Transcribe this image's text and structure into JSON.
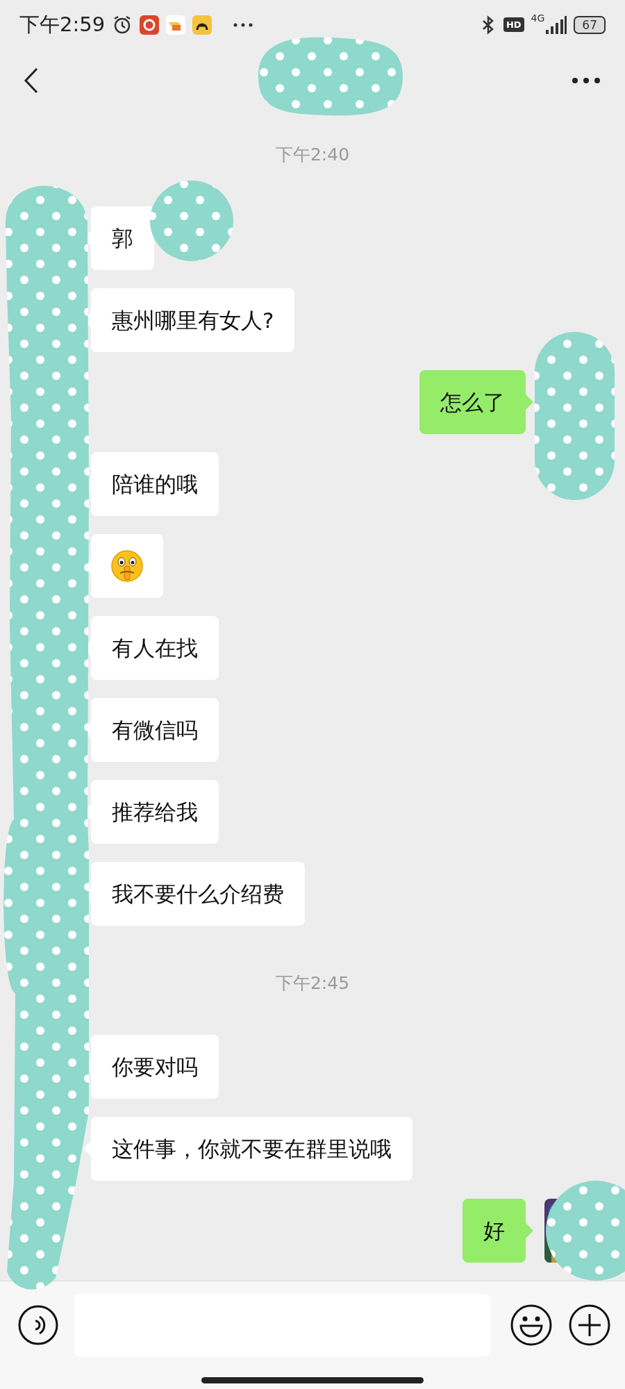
{
  "status_bar": {
    "time": "下午2:59",
    "hd": "HD",
    "network": "4G",
    "battery": "67"
  },
  "messages": [
    {
      "kind": "time",
      "text": "下午2:40"
    },
    {
      "kind": "text",
      "outgoing": false,
      "text": "郭"
    },
    {
      "kind": "text",
      "outgoing": false,
      "text": "惠州哪里有女人?"
    },
    {
      "kind": "text",
      "outgoing": true,
      "text": "怎么了"
    },
    {
      "kind": "text",
      "outgoing": false,
      "text": "陪谁的哦"
    },
    {
      "kind": "emoji",
      "outgoing": false
    },
    {
      "kind": "text",
      "outgoing": false,
      "text": "有人在找"
    },
    {
      "kind": "text",
      "outgoing": false,
      "text": "有微信吗"
    },
    {
      "kind": "text",
      "outgoing": false,
      "text": "推荐给我"
    },
    {
      "kind": "text",
      "outgoing": false,
      "text": "我不要什么介绍费"
    },
    {
      "kind": "time",
      "text": "下午2:45"
    },
    {
      "kind": "text",
      "outgoing": false,
      "text": "你要对吗"
    },
    {
      "kind": "text",
      "outgoing": false,
      "text": "这件事，你就不要在群里说哦"
    },
    {
      "kind": "text",
      "outgoing": true,
      "text": "好"
    }
  ]
}
